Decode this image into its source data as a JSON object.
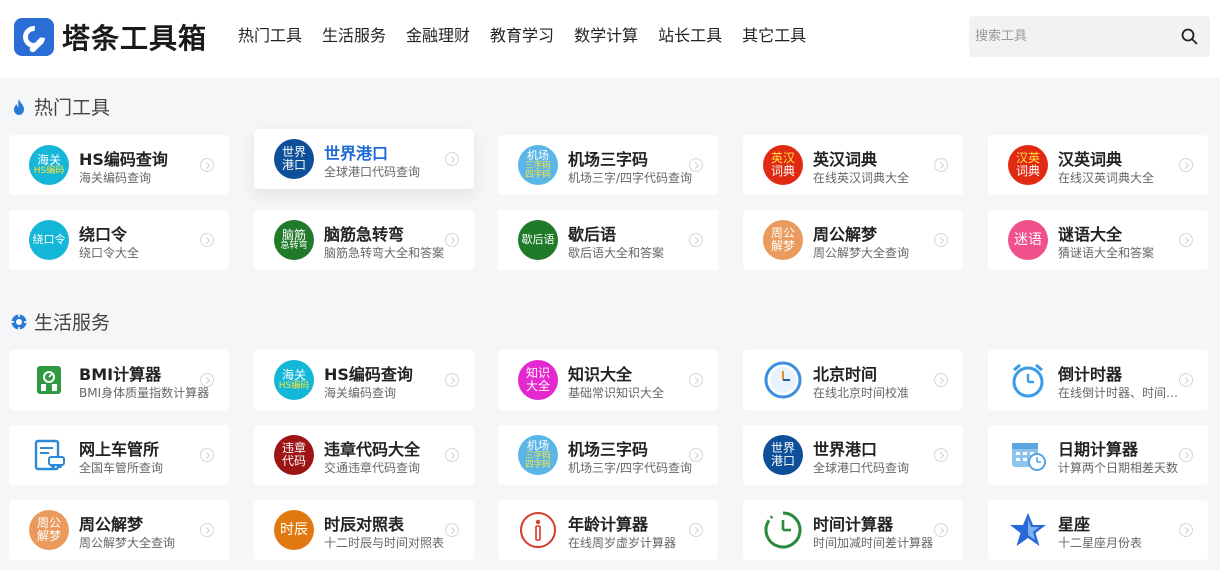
{
  "logo": {
    "text": "塔条工具箱"
  },
  "nav": [
    "热门工具",
    "生活服务",
    "金融理财",
    "教育学习",
    "数学计算",
    "站长工具",
    "其它工具"
  ],
  "search": {
    "placeholder": "搜索工具",
    "value": ""
  },
  "sections": [
    {
      "title": "热门工具",
      "icon": "fire-icon",
      "cards": [
        {
          "title": "HS编码查询",
          "sub": "海关编码查询",
          "icon": {
            "lines": [
              "海关",
              "HS编码"
            ],
            "color": "#14b7d8",
            "text2": "#ffe23a"
          }
        },
        {
          "title": "世界港口",
          "sub": "全球港口代码查询",
          "icon": {
            "lines": [
              "世界",
              "港口"
            ],
            "color": "#0e4f9a"
          }
        },
        {
          "title": "机场三字码",
          "sub": "机场三字/四字代码查询",
          "icon": {
            "lines": [
              "机场",
              "三字码",
              "四字码"
            ],
            "color": "#5bb6e8"
          }
        },
        {
          "title": "英汉词典",
          "sub": "在线英汉词典大全",
          "icon": {
            "lines": [
              "英汉",
              "词典"
            ],
            "color": "#e02a14",
            "text1": "#ffe23a"
          }
        },
        {
          "title": "汉英词典",
          "sub": "在线汉英词典大全",
          "icon": {
            "lines": [
              "汉英",
              "词典"
            ],
            "color": "#e02a14",
            "text1": "#ffe23a"
          }
        },
        {
          "title": "绕口令",
          "sub": "绕口令大全",
          "icon": {
            "lines": [
              "绕口令"
            ],
            "color": "#14b7d8"
          }
        },
        {
          "title": "脑筋急转弯",
          "sub": "脑筋急转弯大全和答案",
          "icon": {
            "lines": [
              "脑筋",
              "急转弯"
            ],
            "color": "#1f7a2a"
          }
        },
        {
          "title": "歇后语",
          "sub": "歇后语大全和答案",
          "icon": {
            "lines": [
              "歇后语"
            ],
            "color": "#1f7a2a"
          }
        },
        {
          "title": "周公解梦",
          "sub": "周公解梦大全查询",
          "icon": {
            "lines": [
              "周公",
              "解梦"
            ],
            "color": "#e99a5c"
          }
        },
        {
          "title": "谜语大全",
          "sub": "猜谜语大全和答案",
          "icon": {
            "lines": [
              "迷语"
            ],
            "color": "#f0508c"
          }
        }
      ]
    },
    {
      "title": "生活服务",
      "icon": "gear-icon",
      "cards": [
        {
          "title": "BMI计算器",
          "sub": "BMI身体质量指数计算器",
          "icon": {
            "glyph": "scale-icon",
            "color": "#2f9a42"
          }
        },
        {
          "title": "HS编码查询",
          "sub": "海关编码查询",
          "icon": {
            "lines": [
              "海关",
              "HS编码"
            ],
            "color": "#14b7d8",
            "text2": "#ffe23a"
          }
        },
        {
          "title": "知识大全",
          "sub": "基础常识知识大全",
          "icon": {
            "lines": [
              "知识",
              "大全"
            ],
            "color": "#e428d0"
          }
        },
        {
          "title": "北京时间",
          "sub": "在线北京时间校准",
          "icon": {
            "glyph": "clock-icon",
            "color": "#3a8fe0"
          }
        },
        {
          "title": "倒计时器",
          "sub": "在线倒计时器、时间倒计时",
          "icon": {
            "glyph": "alarm-icon",
            "color": "#3a9be8"
          }
        },
        {
          "title": "网上车管所",
          "sub": "全国车管所查询",
          "icon": {
            "glyph": "car-form-icon",
            "color": "#2a8ad8"
          }
        },
        {
          "title": "违章代码大全",
          "sub": "交通违章代码查询",
          "icon": {
            "lines": [
              "违章",
              "代码"
            ],
            "color": "#9c1414"
          }
        },
        {
          "title": "机场三字码",
          "sub": "机场三字/四字代码查询",
          "icon": {
            "lines": [
              "机场",
              "三字码",
              "四字码"
            ],
            "color": "#5bb6e8"
          }
        },
        {
          "title": "世界港口",
          "sub": "全球港口代码查询",
          "icon": {
            "lines": [
              "世界",
              "港口"
            ],
            "color": "#0e4f9a"
          }
        },
        {
          "title": "日期计算器",
          "sub": "计算两个日期相差天数",
          "icon": {
            "glyph": "calendar-icon",
            "color": "#8cc4ee"
          }
        },
        {
          "title": "周公解梦",
          "sub": "周公解梦大全查询",
          "icon": {
            "lines": [
              "周公",
              "解梦"
            ],
            "color": "#e99a5c"
          }
        },
        {
          "title": "时辰对照表",
          "sub": "十二时辰与时间对照表",
          "icon": {
            "lines": [
              "时辰"
            ],
            "color": "#e07a10"
          }
        },
        {
          "title": "年龄计算器",
          "sub": "在线周岁虚岁计算器",
          "icon": {
            "glyph": "age-icon",
            "color": "#d83a2a"
          }
        },
        {
          "title": "时间计算器",
          "sub": "时间加减时间差计算器",
          "icon": {
            "glyph": "timer-icon",
            "color": "#2a8a3a"
          }
        },
        {
          "title": "星座",
          "sub": "十二星座月份表",
          "icon": {
            "glyph": "star-icon",
            "color": "#2a68d8"
          }
        }
      ]
    }
  ]
}
